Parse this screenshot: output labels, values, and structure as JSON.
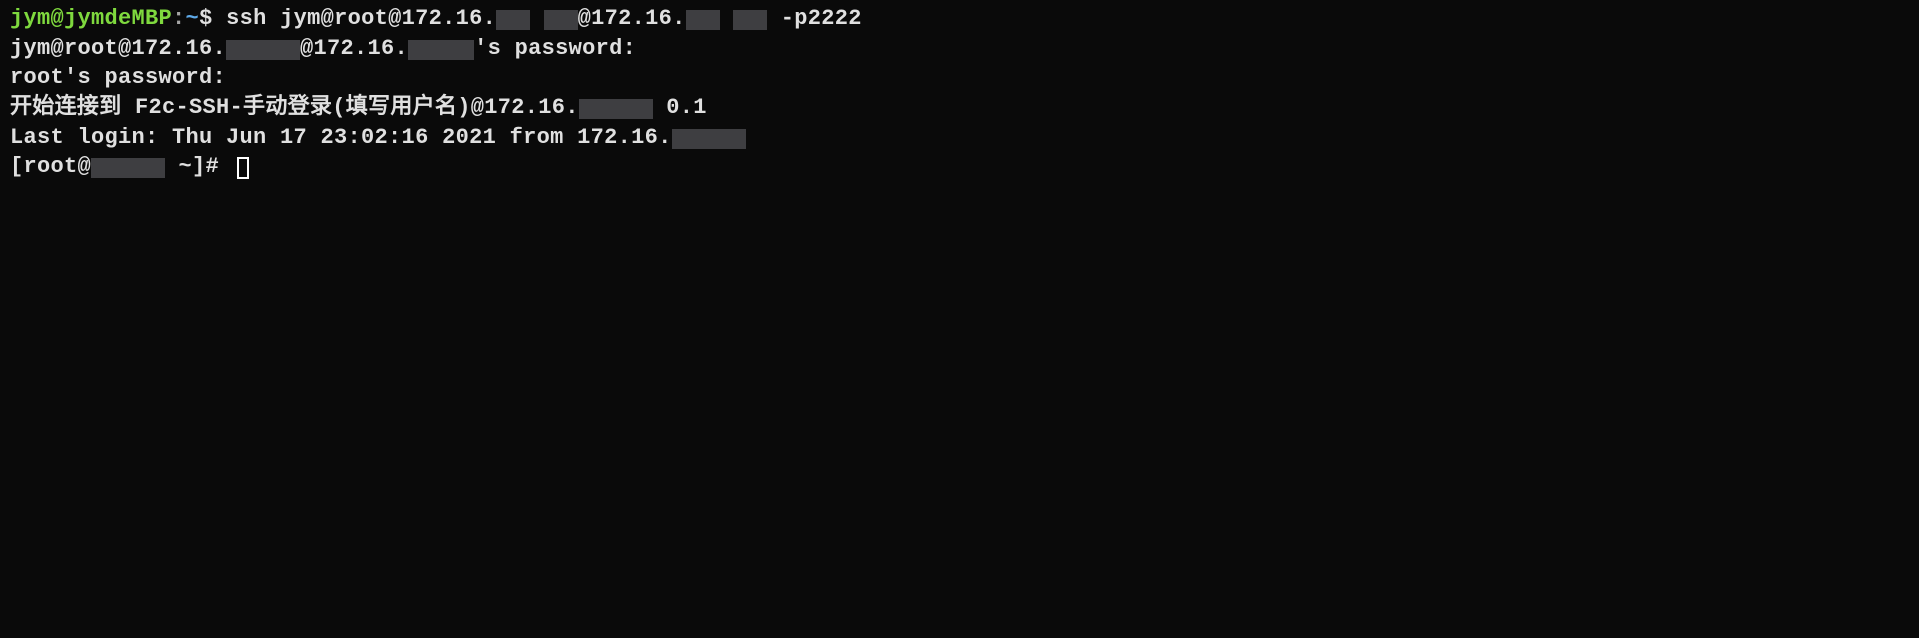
{
  "prompt1": {
    "user_host": "jym@jymdeMBP",
    "colon": ":",
    "tilde": "~",
    "dollar": "$ ",
    "cmd_prefix": "ssh jym@root@172.16.",
    "cmd_mid": "@172.16.",
    "cmd_suffix": " -p2222"
  },
  "line2": {
    "prefix": "jym@root@172.16.",
    "mid": "@172.16.",
    "suffix": "'s password:"
  },
  "line3": {
    "text": "root's password:"
  },
  "line4": {
    "prefix": "开始连接到 F2c-SSH-手动登录(填写用户名)@172.16.",
    "suffix": " 0.1"
  },
  "line5": {
    "prefix": "Last login: Thu Jun 17 23:02:16 2021 from 172.16."
  },
  "line6": {
    "prefix": "[root@",
    "suffix": " ~]# "
  }
}
